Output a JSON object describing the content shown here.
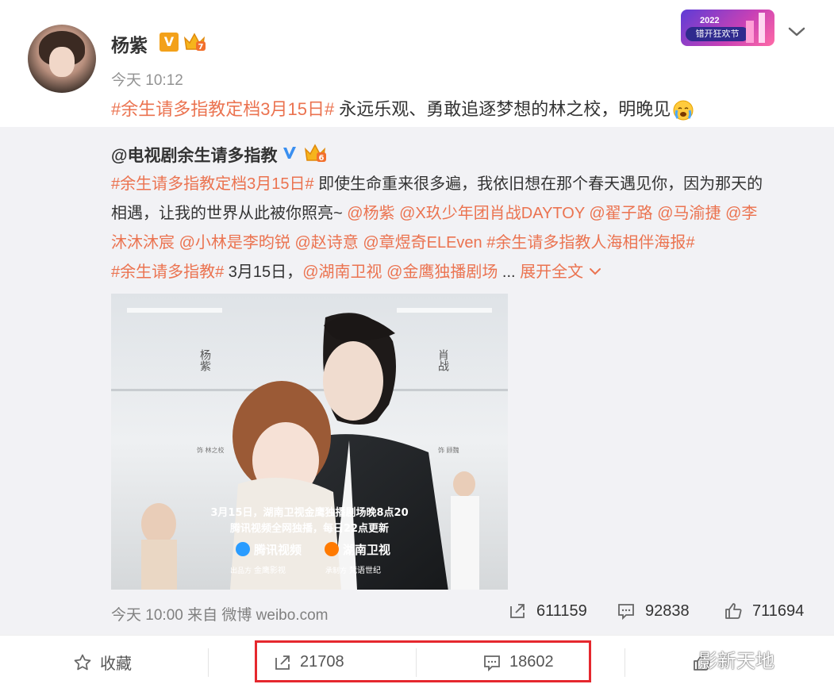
{
  "post": {
    "author": "杨紫",
    "vip_badge": "V",
    "time": "今天 10:12",
    "hashtag": "#余生请多指教定档3月15日#",
    "text": " 永远乐观、勇敢追逐梦想的林之校，明晚见"
  },
  "banner": {
    "year": "2022",
    "label": "错开狂欢节"
  },
  "repost": {
    "author": "@电视剧余生请多指教",
    "lines": [
      [
        {
          "t": "#余生请多指教定档3月15日#",
          "h": true
        },
        {
          "t": " 即使生命重来很多遍，我依旧想在那个春天遇见你，因为那天的",
          "h": false
        }
      ],
      [
        {
          "t": "相遇，让我的世界从此被你照亮~ ",
          "h": false
        },
        {
          "t": "@杨紫",
          "h": true
        },
        {
          "t": " ",
          "h": false
        },
        {
          "t": "@X玖少年团肖战DAYTOY",
          "h": true
        },
        {
          "t": " ",
          "h": false
        },
        {
          "t": "@翟子路",
          "h": true
        },
        {
          "t": " ",
          "h": false
        },
        {
          "t": "@马渝捷",
          "h": true
        },
        {
          "t": " ",
          "h": false
        },
        {
          "t": "@李",
          "h": true
        }
      ],
      [
        {
          "t": "沐沐沐宸",
          "h": true
        },
        {
          "t": " ",
          "h": false
        },
        {
          "t": "@小林是李昀锐",
          "h": true
        },
        {
          "t": " ",
          "h": false
        },
        {
          "t": "@赵诗意",
          "h": true
        },
        {
          "t": " ",
          "h": false
        },
        {
          "t": "@章煜奇ELEven",
          "h": true
        },
        {
          "t": " ",
          "h": false
        },
        {
          "t": "#余生请多指教人海相伴海报#",
          "h": true
        }
      ],
      [
        {
          "t": "#余生请多指教#",
          "h": true
        },
        {
          "t": " 3月15日，",
          "h": false
        },
        {
          "t": "@湖南卫视",
          "h": true
        },
        {
          "t": " ",
          "h": false
        },
        {
          "t": "@金鹰独播剧场",
          "h": true
        },
        {
          "t": " ... ",
          "h": false
        },
        {
          "t": "展开全文",
          "h": true
        }
      ]
    ],
    "poster": {
      "name_left": "杨紫",
      "role_left": "饰 林之校",
      "name_right": "肖战",
      "role_right": "饰 顾魏",
      "tagline_1": "3月15日，湖南卫视金鹰独播剧场晚8点20",
      "tagline_2": "腾讯视频全网独播，每日22点更新",
      "logo_1": "腾讯视频",
      "logo_2": "湖南卫视",
      "producer_label": "出品方",
      "producer": "金鹰影视",
      "cofounder_label": "承制方",
      "cofounder": "梵语世纪"
    },
    "footer": "今天 10:00 来自 微博 weibo.com",
    "reposts": "611159",
    "comments": "92838",
    "likes": "711694"
  },
  "actions": {
    "favorite": "收藏",
    "reposts": "21708",
    "comments": "18602"
  },
  "watermark": "影新天地",
  "colors": {
    "link": "#eb7350",
    "highlight": "#e5282e",
    "muted": "#939393"
  }
}
